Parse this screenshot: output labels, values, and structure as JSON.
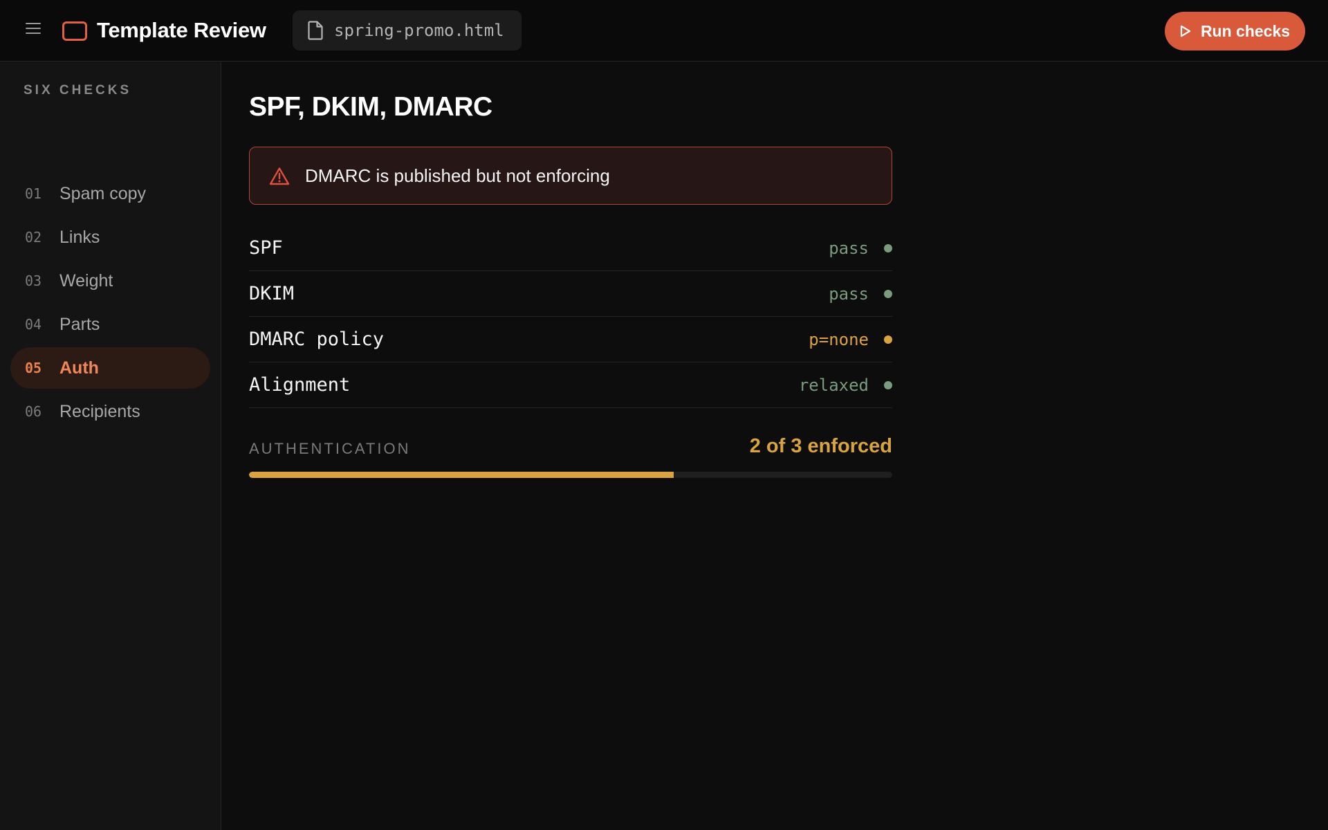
{
  "header": {
    "app_title": "Template Review",
    "file_name": "spring-promo.html",
    "run_label": "Run checks"
  },
  "sidebar": {
    "heading": "SIX CHECKS",
    "items": [
      {
        "num": "01",
        "label": "Spam copy",
        "active": false
      },
      {
        "num": "02",
        "label": "Links",
        "active": false
      },
      {
        "num": "03",
        "label": "Weight",
        "active": false
      },
      {
        "num": "04",
        "label": "Parts",
        "active": false
      },
      {
        "num": "05",
        "label": "Auth",
        "active": true
      },
      {
        "num": "06",
        "label": "Recipients",
        "active": false
      }
    ]
  },
  "main": {
    "title": "SPF, DKIM, DMARC",
    "alert": {
      "text": "DMARC is published but not enforcing",
      "icon": "warning-icon"
    },
    "checks": [
      {
        "name": "SPF",
        "value": "pass",
        "status": "ok"
      },
      {
        "name": "DKIM",
        "value": "pass",
        "status": "ok"
      },
      {
        "name": "DMARC policy",
        "value": "p=none",
        "status": "warn"
      },
      {
        "name": "Alignment",
        "value": "relaxed",
        "status": "ok"
      }
    ],
    "summary": {
      "label": "AUTHENTICATION",
      "value": "2 of 3 enforced",
      "progress": 0.66
    }
  },
  "colors": {
    "accent": "#d85a3a",
    "ok": "#7a9c7e",
    "warn": "#d9a440",
    "alert_border": "#b5473a"
  }
}
